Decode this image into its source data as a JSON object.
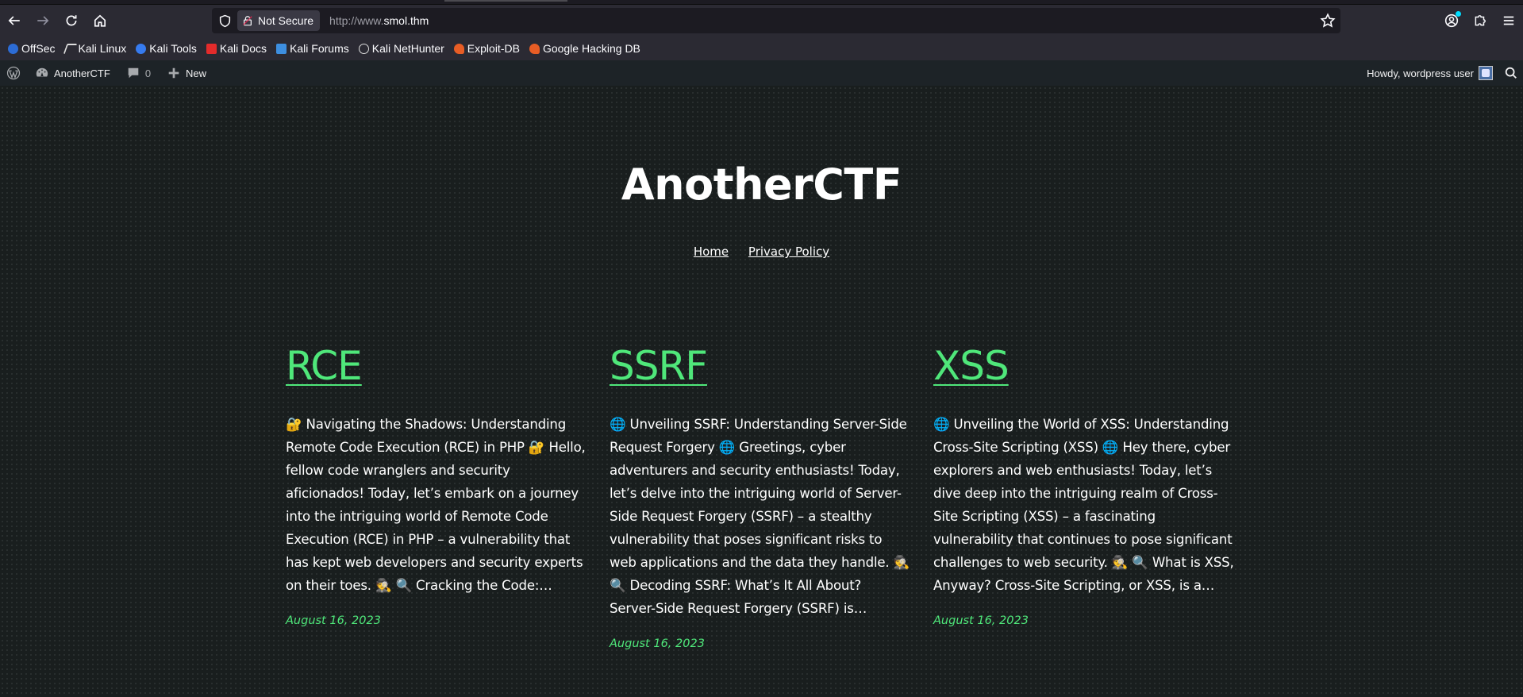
{
  "browser": {
    "security_label": "Not Secure",
    "url_prefix": "http://www.",
    "url_host": "smol.thm",
    "bookmarks": [
      {
        "label": "OffSec",
        "color": "#2c6cd6"
      },
      {
        "label": "Kali Linux",
        "color": "#2b2a33"
      },
      {
        "label": "Kali Tools",
        "color": "#367bf0"
      },
      {
        "label": "Kali Docs",
        "color": "#e42b2b"
      },
      {
        "label": "Kali Forums",
        "color": "#3d8fe0"
      },
      {
        "label": "Kali NetHunter",
        "color": "#2b2a33"
      },
      {
        "label": "Exploit-DB",
        "color": "#e85d25"
      },
      {
        "label": "Google Hacking DB",
        "color": "#e85d25"
      }
    ]
  },
  "adminbar": {
    "site_name": "AnotherCTF",
    "comments_count": "0",
    "new_label": "New",
    "greeting": "Howdy, wordpress user"
  },
  "site": {
    "title": "AnotherCTF",
    "nav": [
      "Home",
      "Privacy Policy"
    ]
  },
  "posts": [
    {
      "title": "RCE",
      "excerpt": "🔐 Navigating the Shadows: Understanding Remote Code Execution (RCE) in PHP 🔐 Hello, fellow code wranglers and security aficionados! Today, let’s embark on a journey into the intriguing world of Remote Code Execution (RCE) in PHP – a vulnerability that has kept web developers and security experts on their toes. 🕵️ 🔍 Cracking the Code:…",
      "date": "August 16, 2023"
    },
    {
      "title": "SSRF",
      "excerpt": "🌐 Unveiling SSRF: Understanding Server-Side Request Forgery 🌐 Greetings, cyber adventurers and security enthusiasts! Today, let’s delve into the intriguing world of Server-Side Request Forgery (SSRF) – a stealthy vulnerability that poses significant risks to web applications and the data they handle. 🕵️ 🔍 Decoding SSRF: What’s It All About? Server-Side Request Forgery (SSRF) is…",
      "date": "August 16, 2023"
    },
    {
      "title": "XSS",
      "excerpt": "🌐 Unveiling the World of XSS: Understanding Cross-Site Scripting (XSS) 🌐 Hey there, cyber explorers and web enthusiasts! Today, let’s dive deep into the intriguing realm of Cross-Site Scripting (XSS) – a fascinating vulnerability that continues to pose significant challenges to web security. 🕵️ 🔍 What is XSS, Anyway? Cross-Site Scripting, or XSS, is a…",
      "date": "August 16, 2023"
    }
  ]
}
